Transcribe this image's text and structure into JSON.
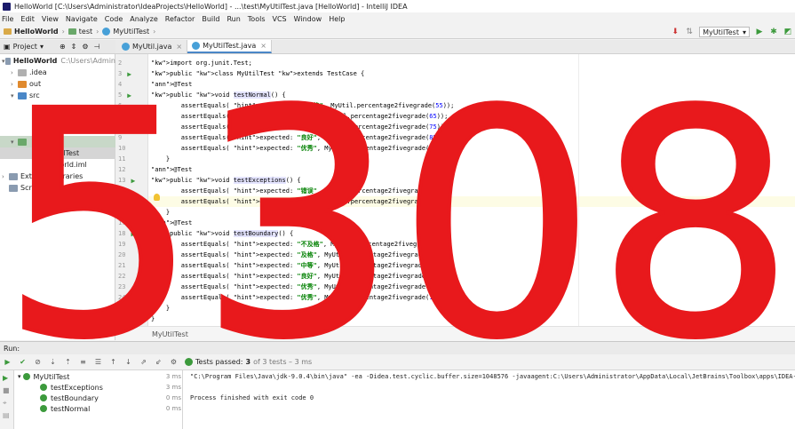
{
  "window": {
    "title": "HelloWorld [C:\\Users\\Administrator\\IdeaProjects\\HelloWorld] - ...\\test\\MyUtilTest.java [HelloWorld] - IntelliJ IDEA"
  },
  "menu": [
    "File",
    "Edit",
    "View",
    "Navigate",
    "Code",
    "Analyze",
    "Refactor",
    "Build",
    "Run",
    "Tools",
    "VCS",
    "Window",
    "Help"
  ],
  "navbar": {
    "crumbs": [
      "HelloWorld",
      "test",
      "MyUtilTest"
    ],
    "run_config": "MyUtilTest"
  },
  "project_panel": {
    "title": "Project",
    "tree": [
      {
        "label": "HelloWorld",
        "extra": "C:\\Users\\Admin"
      },
      {
        "label": ".idea"
      },
      {
        "label": "out"
      },
      {
        "label": "src"
      },
      {
        "label": "Util"
      },
      {
        "label": "UtilTest"
      },
      {
        "label": "World.iml"
      },
      {
        "label": "External Libraries"
      },
      {
        "label": "Scratches and Consoles"
      }
    ]
  },
  "tabs": [
    {
      "label": "MyUtil.java"
    },
    {
      "label": "MyUtilTest.java"
    }
  ],
  "code": {
    "lines": [
      {
        "n": "2",
        "t": "import org.junit.Test;"
      },
      {
        "n": "3",
        "t": "public class MyUtilTest extends TestCase {"
      },
      {
        "n": "4",
        "t": "    @Test"
      },
      {
        "n": "5",
        "t": "    public void testNormal() {"
      },
      {
        "n": "6",
        "t": "        assertEquals( expected: \"不及格\", MyUtil.percentage2fivegrade(55));"
      },
      {
        "n": "7",
        "t": "        assertEquals( expected: \"及格\", MyUtil.percentage2fivegrade(65));"
      },
      {
        "n": "8",
        "t": "        assertEquals( expected: \"中等\", MyUtil.percentage2fivegrade(75));"
      },
      {
        "n": "9",
        "t": "        assertEquals( expected: \"良好\", MyUtil.percentage2fivegrade(85));"
      },
      {
        "n": "10",
        "t": "        assertEquals( expected: \"优秀\", MyUtil.percentage2fivegrade(95));"
      },
      {
        "n": "11",
        "t": "    }"
      },
      {
        "n": "12",
        "t": "    @Test"
      },
      {
        "n": "13",
        "t": "    public void testExceptions() {"
      },
      {
        "n": "14",
        "t": "        assertEquals( expected: \"错误\", MyUtil.percentage2fivegrade(105));"
      },
      {
        "n": "15",
        "t": "        assertEquals( expected: \"错误\", MyUtil.percentage2fivegrade(-55));"
      },
      {
        "n": "16",
        "t": "    }"
      },
      {
        "n": "17",
        "t": "    @Test"
      },
      {
        "n": "18",
        "t": "    public void testBoundary() {"
      },
      {
        "n": "19",
        "t": "        assertEquals( expected: \"不及格\", MyUtil.percentage2fivegrade(0));"
      },
      {
        "n": "20",
        "t": "        assertEquals( expected: \"及格\", MyUtil.percentage2fivegrade(60));"
      },
      {
        "n": "21",
        "t": "        assertEquals( expected: \"中等\", MyUtil.percentage2fivegrade(70));"
      },
      {
        "n": "22",
        "t": "        assertEquals( expected: \"良好\", MyUtil.percentage2fivegrade(80));"
      },
      {
        "n": "23",
        "t": "        assertEquals( expected: \"优秀\", MyUtil.percentage2fivegrade(90));"
      },
      {
        "n": "24",
        "t": "        assertEquals( expected: \"优秀\", MyUtil.percentage2fivegrade(100));"
      },
      {
        "n": "25",
        "t": "    }"
      },
      {
        "n": "26",
        "t": "}"
      }
    ]
  },
  "editor_breadcrumb": "MyUtilTest",
  "run_panel": {
    "title": "Run:",
    "status": "Tests passed:",
    "passed_count": "3",
    "status_sub": "of 3 tests – 3 ms",
    "tests": [
      {
        "name": "MyUtilTest",
        "time": "3 ms"
      },
      {
        "name": "testExceptions",
        "time": "3 ms"
      },
      {
        "name": "testBoundary",
        "time": "0 ms"
      },
      {
        "name": "testNormal",
        "time": "0 ms"
      }
    ],
    "console": [
      "\"C:\\Program Files\\Java\\jdk-9.0.4\\bin\\java\" -ea -Didea.test.cyclic.buffer.size=1048576 -javaagent:C:\\Users\\Administrator\\AppData\\Local\\JetBrains\\Toolbox\\apps\\IDEA-U\\ch-0\\",
      "Process finished with exit code 0"
    ]
  },
  "overlay": {
    "text": "5308",
    "color": "#e8191c"
  }
}
